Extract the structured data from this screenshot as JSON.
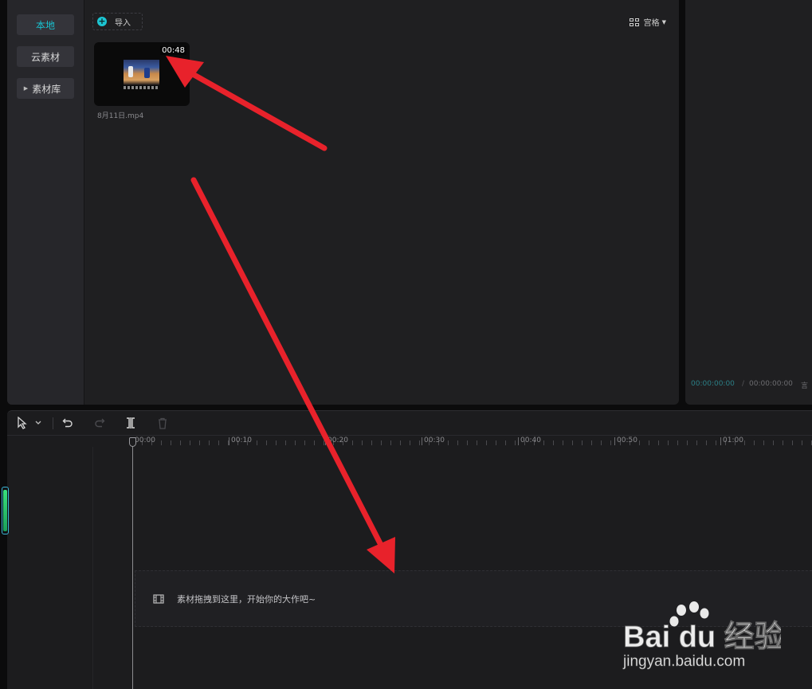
{
  "sidebar": {
    "local": "本地",
    "cloud": "云素材",
    "library": "素材库"
  },
  "media": {
    "import_label": "导入",
    "view_label": "宫格",
    "clip": {
      "duration": "00:48",
      "filename": "8月11日.mp4"
    }
  },
  "preview": {
    "current_time": "00:00:00:00",
    "separator": "/",
    "total_time": "00:00:00:00",
    "cut": "言"
  },
  "timeline": {
    "ruler_labels": [
      "00:00",
      "00:10",
      "00:20",
      "00:30",
      "00:40",
      "00:50",
      "01:00"
    ],
    "drop_hint": "素材拖拽到这里，开始你的大作吧~"
  },
  "watermark": {
    "brand": "Bai du 经验",
    "url": "jingyan.baidu.com"
  },
  "colors": {
    "accent": "#1cc6d3",
    "annotation": "#e8222b",
    "panel": "#1f1f21"
  },
  "icons": [
    "plus-icon",
    "grid-icon",
    "cursor-icon",
    "undo-icon",
    "redo-icon",
    "split-icon",
    "delete-icon",
    "film-icon"
  ]
}
